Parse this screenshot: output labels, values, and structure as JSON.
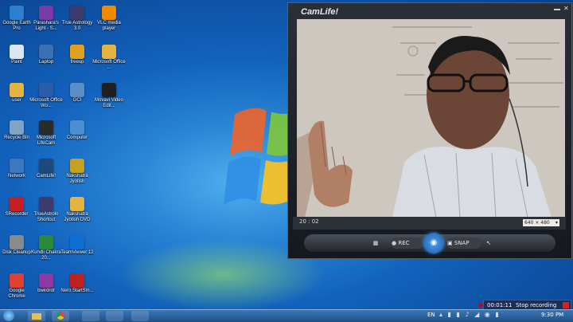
{
  "desktop": {
    "icons": [
      {
        "label": "Google Earth Pro",
        "icon": "google-earth-icon",
        "color": "#2f7fd0"
      },
      {
        "label": "Parashara's Light - S...",
        "icon": "parashara-icon",
        "color": "#7b3aa8"
      },
      {
        "label": "True Astrology 3.0",
        "icon": "astrology-icon",
        "color": "#3b3b6e"
      },
      {
        "label": "VLC media player",
        "icon": "vlc-icon",
        "color": "#f08a00"
      },
      {
        "label": "Paint",
        "icon": "paint-icon",
        "color": "#d9e7f3"
      },
      {
        "label": "Laptop",
        "icon": "laptop-icon",
        "color": "#3d6fb3"
      },
      {
        "label": "freeup",
        "icon": "freeup-icon",
        "color": "#e0a020"
      },
      {
        "label": "Microsoft Office ...",
        "icon": "office-folder-icon",
        "color": "#e3b440"
      },
      {
        "label": "user",
        "icon": "user-folder-icon",
        "color": "#e3b440"
      },
      {
        "label": "Microsoft Office Wo...",
        "icon": "word-icon",
        "color": "#2a5caa"
      },
      {
        "label": "GCI",
        "icon": "gci-icon",
        "color": "#5a8fc8"
      },
      {
        "label": "Movavi Video Edit...",
        "icon": "movavi-icon",
        "color": "#1f1f1f"
      },
      {
        "label": "Recycle Bin",
        "icon": "recycle-bin-icon",
        "color": "#7fa4c4"
      },
      {
        "label": "Microsoft LifeCam",
        "icon": "lifecam-icon",
        "color": "#2b2b2b"
      },
      {
        "label": "Computer",
        "icon": "computer-icon",
        "color": "#4a90d0"
      },
      {
        "label": "Network",
        "icon": "network-icon",
        "color": "#3b78c0"
      },
      {
        "label": "CamLife!",
        "icon": "camlife-icon",
        "color": "#1d4a7a"
      },
      {
        "label": "Nakshatra Jyotish",
        "icon": "nakshatra-icon",
        "color": "#c8a020"
      },
      {
        "label": "SRecorder",
        "icon": "srecorder-icon",
        "color": "#c42020"
      },
      {
        "label": "TrueAstrolo Shortcut",
        "icon": "trueastro-shortcut-icon",
        "color": "#3b3b6e"
      },
      {
        "label": "Nakshatra Jyotish DVD",
        "icon": "nakshatra-dvd-icon",
        "color": "#e3b440"
      },
      {
        "label": "Disk Cleanup",
        "icon": "disk-cleanup-icon",
        "color": "#8a8a8a"
      },
      {
        "label": "Kundli Chakra 20...",
        "icon": "kundli-icon",
        "color": "#2a8a3a"
      },
      {
        "label": "TeamViewer 12",
        "icon": "teamviewer-icon",
        "color": "#0e6fd0"
      },
      {
        "label": "Google Chrome",
        "icon": "chrome-icon",
        "color": "#e04030"
      },
      {
        "label": "bwirdrdr",
        "icon": "bwirdrdr-icon",
        "color": "#8a3aa0"
      },
      {
        "label": "Nero StartSm...",
        "icon": "nero-icon",
        "color": "#c02020"
      }
    ]
  },
  "camlife": {
    "title": "CamLife!",
    "timestamp": "20 : 02",
    "resolution": "640 × 480",
    "rec_label": "REC",
    "snap_label": "SNAP"
  },
  "recorder": {
    "elapsed": "00:01:11",
    "stop_label": "Stop recording"
  },
  "tray": {
    "language": "EN",
    "clock": "9:30 PM"
  },
  "colors": {
    "accent": "#1a74d0",
    "record_red": "#d32020"
  }
}
